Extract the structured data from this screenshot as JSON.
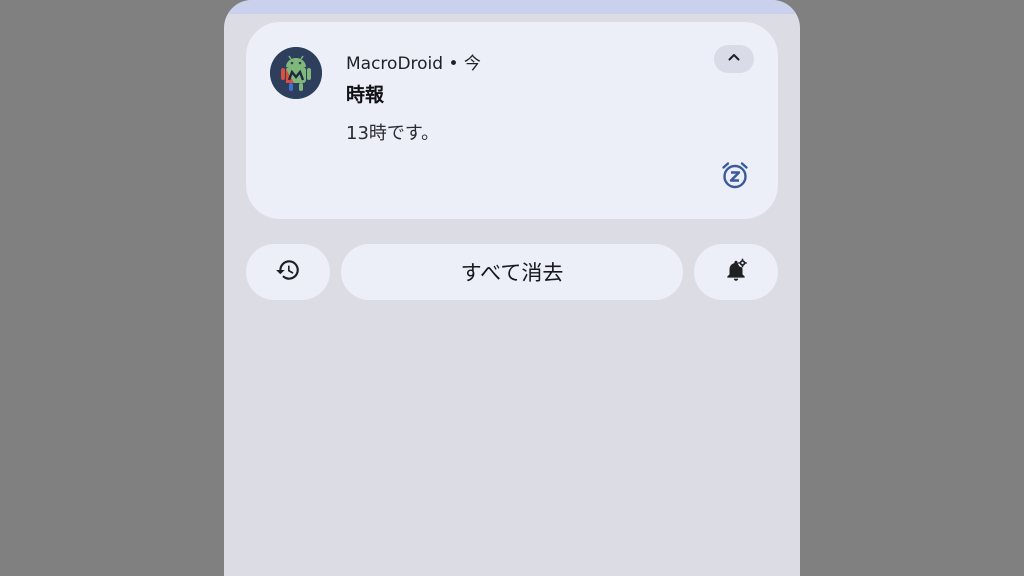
{
  "notification": {
    "app_name": "MacroDroid",
    "separator": "•",
    "time": "今",
    "title": "時報",
    "text": "13時です。",
    "app_icon": "macrodroid-android-robot-icon",
    "collapse_icon": "chevron-up-icon",
    "snooze_icon": "snooze-alarm-icon"
  },
  "actions": {
    "history_icon": "history-icon",
    "clear_all_label": "すべて消去",
    "settings_icon": "notification-settings-icon"
  },
  "colors": {
    "backdrop": "#808080",
    "shade": "#dcdce5",
    "card": "#eceef8",
    "accent": "#3a5a9c"
  }
}
